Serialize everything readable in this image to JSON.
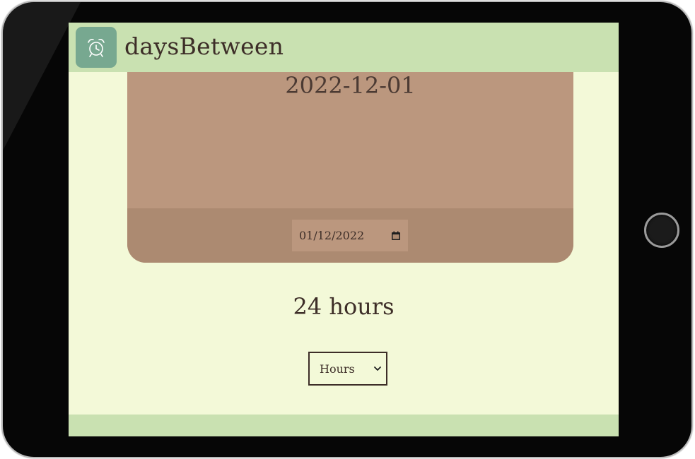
{
  "app": {
    "title": "daysBetween",
    "logo_icon": "alarm-clock-icon"
  },
  "date_card": {
    "date": "2022-12-01",
    "input_value": "01/12/2022",
    "input_icon": "calendar-icon"
  },
  "result": {
    "text": "24 hours"
  },
  "unit_select": {
    "selected": "Hours",
    "icon": "chevron-down-icon"
  },
  "colors": {
    "header_bg": "#c9e1b1",
    "page_bg": "#f3f9d8",
    "logo_bg": "#77a890",
    "card_bg": "#bb977e",
    "card_footer_bg": "#ac8a71",
    "text": "#3d2e28"
  }
}
